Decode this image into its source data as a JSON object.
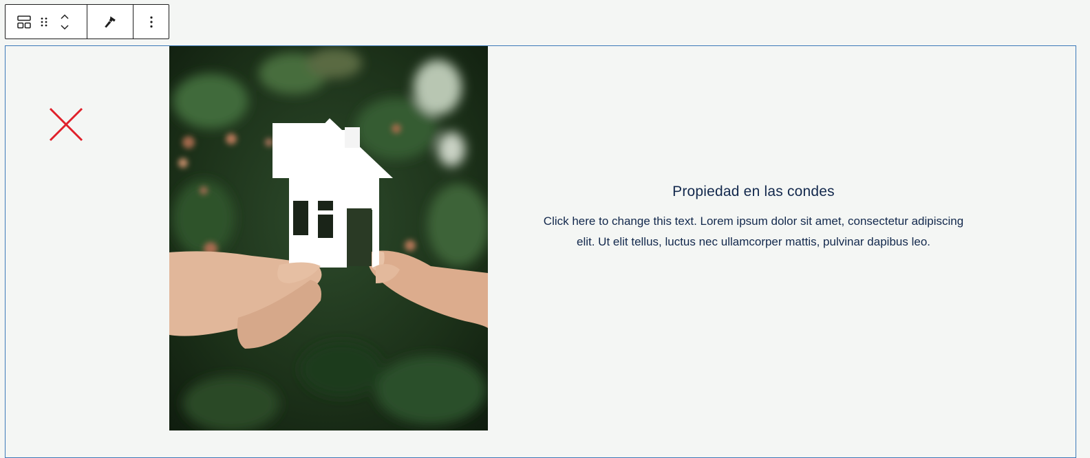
{
  "toolbar": {
    "buttons": [
      "block-type",
      "drag-handle",
      "move-up",
      "move-down",
      "styles",
      "options"
    ]
  },
  "content": {
    "heading": "Propiedad en las condes",
    "body": "Click here to change this text. Lorem ipsum dolor sit amet, consectetur adipiscing elit. Ut elit tellus, luctus nec ullamcorper mattis, pulvinar dapibus leo."
  },
  "colors": {
    "accent_border": "#3a78b8",
    "x_mark": "#e0202a",
    "text": "#12284c",
    "background": "#f4f6f4"
  }
}
